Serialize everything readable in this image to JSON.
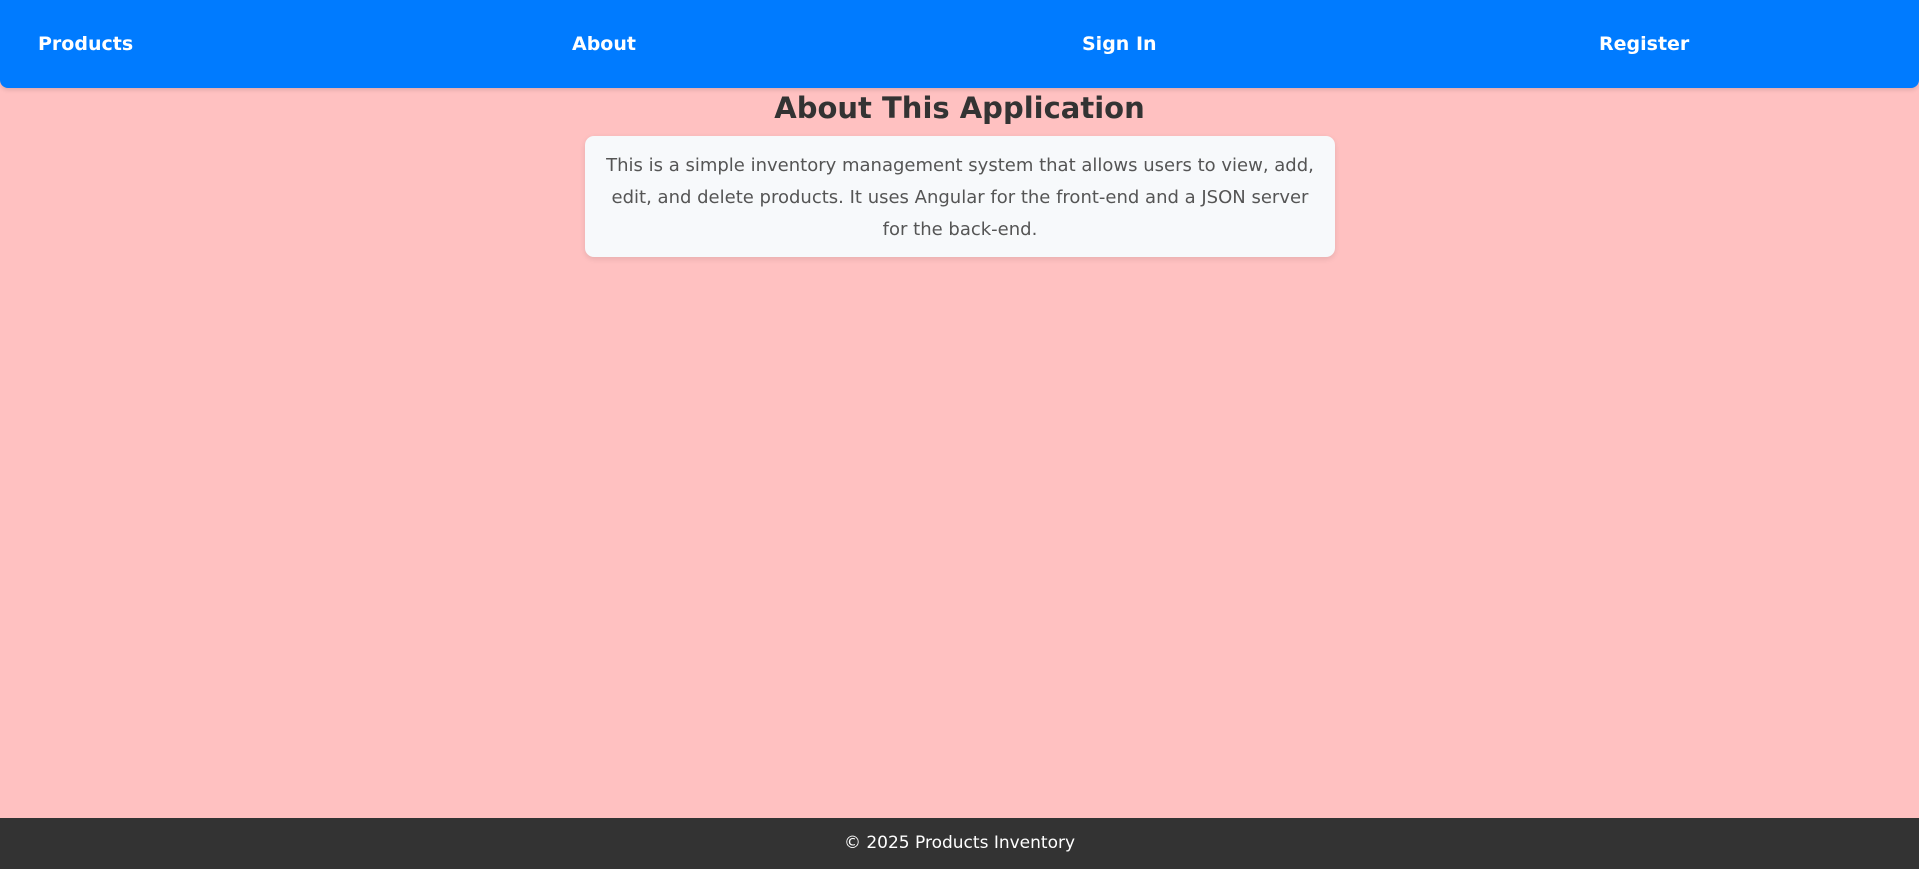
{
  "nav": {
    "items": [
      {
        "label": "Products"
      },
      {
        "label": "About"
      },
      {
        "label": "Sign In"
      },
      {
        "label": "Register"
      }
    ]
  },
  "main": {
    "title": "About This Application",
    "description": "This is a simple inventory management system that allows users to view, add, edit, and delete products. It uses Angular for the front-end and a JSON server for the back-end."
  },
  "footer": {
    "text": "© 2025 Products Inventory"
  },
  "colors": {
    "navbar": "#007bff",
    "page_background": "#ffc1c1",
    "card_background": "#f7f9fb",
    "footer": "#333333"
  }
}
